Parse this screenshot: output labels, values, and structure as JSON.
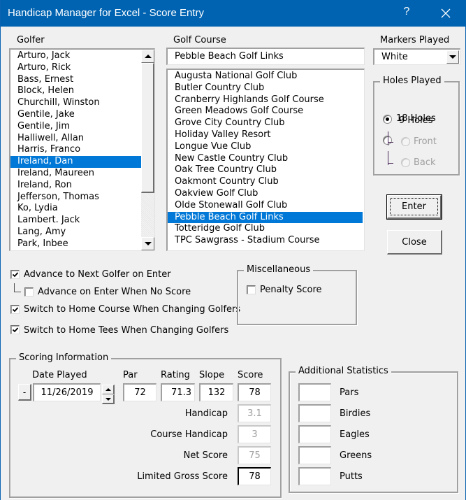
{
  "window": {
    "title": "Handicap Manager for Excel - Score Entry",
    "help_label": "?",
    "close_icon": "close-icon"
  },
  "golfer": {
    "label": "Golfer",
    "selected": "Ireland, Dan",
    "items": [
      "Arturo, Jack",
      "Arturo, Rick",
      "Bass, Ernest",
      "Block, Helen",
      "Churchill, Winston",
      "Gentile, Jake",
      "Gentile, Jim",
      "Halliwell, Allan",
      "Harris, Franco",
      "Ireland, Dan",
      "Ireland, Maureen",
      "Ireland, Ron",
      "Jefferson, Thomas",
      "Ko, Lydia",
      "Lambert. Jack",
      "Lang, Amy",
      "Park, Inbee"
    ]
  },
  "course": {
    "label": "Golf Course",
    "value": "Pebble Beach Golf Links",
    "selected": "Pebble Beach Golf Links",
    "items": [
      "Augusta National Golf Club",
      "Butler Country Club",
      "Cranberry Highlands Golf Course",
      "Green Meadows Golf Course",
      "Grove City Country Club",
      "Holiday Valley Resort",
      "Longue Vue Club",
      "New Castle Country Club",
      "Oak Tree Country Club",
      "Oakmont Country Club",
      "Oakview Golf Club",
      "Olde Stonewall Golf Club",
      "Pebble Beach Golf Links",
      "Totteridge Golf Club",
      "TPC Sawgrass - Stadium Course"
    ]
  },
  "markers": {
    "label": "Markers Played",
    "value": "White"
  },
  "holes": {
    "label": "Holes Played",
    "options": [
      {
        "label": "18 Holes",
        "checked": true,
        "enabled": true
      },
      {
        "label": "9 Holes",
        "checked": false,
        "enabled": true
      },
      {
        "label": "Front",
        "checked": false,
        "enabled": false
      },
      {
        "label": "Back",
        "checked": false,
        "enabled": false
      }
    ]
  },
  "buttons": {
    "enter": "Enter",
    "close": "Close"
  },
  "options": {
    "advance_next": {
      "label": "Advance to Next Golfer on Enter",
      "checked": true
    },
    "advance_no_score": {
      "label": "Advance on Enter When No Score",
      "checked": false
    },
    "home_course": {
      "label": "Switch to Home Course When Changing Golfers",
      "checked": true
    },
    "home_tees": {
      "label": "Switch to Home Tees When Changing Golfers",
      "checked": true
    }
  },
  "misc": {
    "label": "Miscellaneous",
    "penalty": {
      "label": "Penalty Score",
      "checked": false
    }
  },
  "scoring": {
    "label": "Scoring Information",
    "date_label": "Date Played",
    "date_value": "11/26/2019",
    "date_minus": "-",
    "par_label": "Par",
    "par_value": "72",
    "rating_label": "Rating",
    "rating_value": "71.3",
    "slope_label": "Slope",
    "slope_value": "132",
    "score_label": "Score",
    "score_value": "78",
    "handicap_label": "Handicap",
    "handicap_value": "3.1",
    "course_handicap_label": "Course Handicap",
    "course_handicap_value": "3",
    "net_score_label": "Net Score",
    "net_score_value": "75",
    "limited_gross_label": "Limited Gross Score",
    "limited_gross_value": "78"
  },
  "stats": {
    "label": "Additional Statistics",
    "items": [
      {
        "label": "Pars",
        "value": ""
      },
      {
        "label": "Birdies",
        "value": ""
      },
      {
        "label": "Eagles",
        "value": ""
      },
      {
        "label": "Greens",
        "value": ""
      },
      {
        "label": "Putts",
        "value": ""
      }
    ]
  }
}
